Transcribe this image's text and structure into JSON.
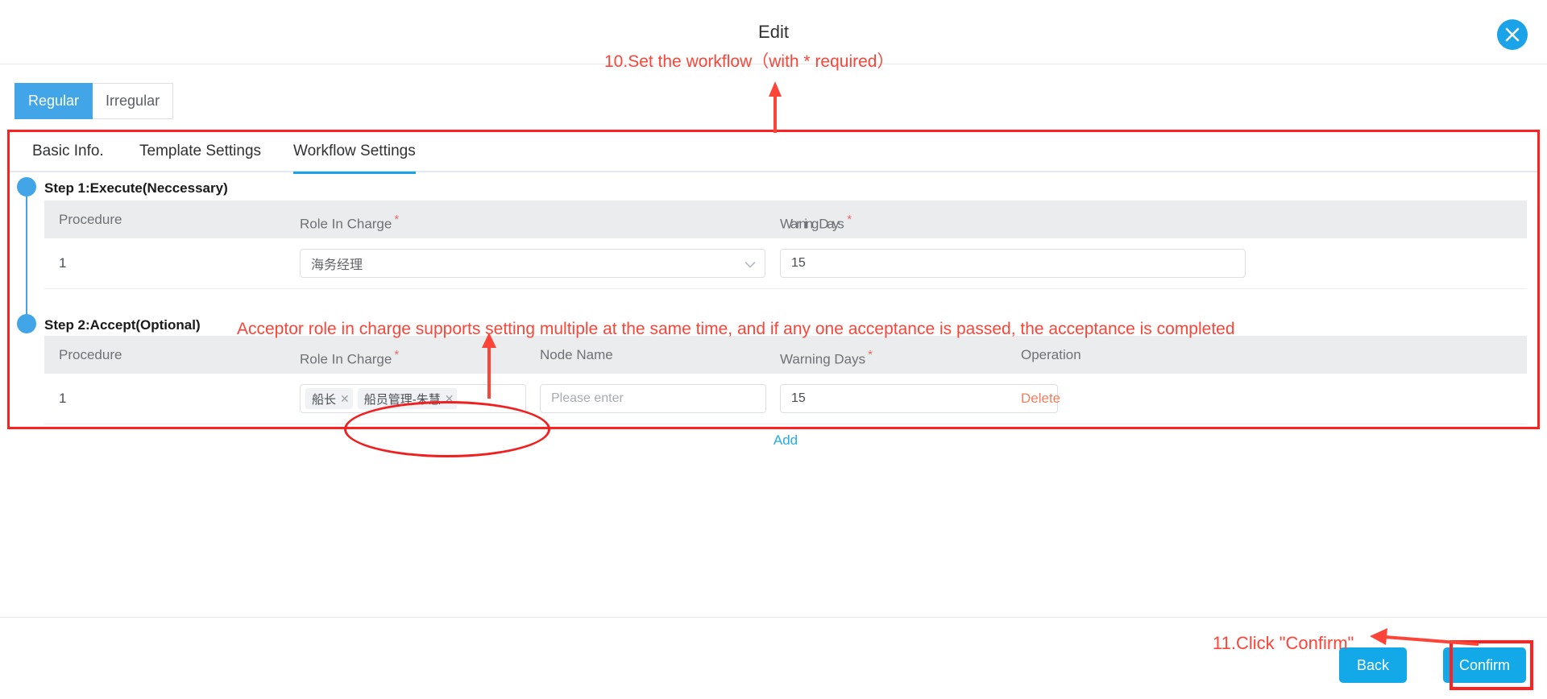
{
  "modal": {
    "title": "Edit",
    "close_icon": "close-icon"
  },
  "segmented": {
    "options": [
      {
        "label": "Regular",
        "active": true
      },
      {
        "label": "Irregular",
        "active": false
      }
    ]
  },
  "tabs": [
    {
      "label": "Basic Info.",
      "active": false
    },
    {
      "label": "Template Settings",
      "active": false
    },
    {
      "label": "Workflow Settings",
      "active": true
    }
  ],
  "steps": [
    {
      "title": "Step 1:Execute(Neccessary)",
      "columns": [
        {
          "label": "Procedure",
          "required": false
        },
        {
          "label": "Role In Charge",
          "required": true
        },
        {
          "label": "Warning Days",
          "required": true
        }
      ],
      "rows": [
        {
          "procedure": "1",
          "role_value": "海务经理",
          "warning_days": "15"
        }
      ]
    },
    {
      "title": "Step 2:Accept(Optional)",
      "columns": [
        {
          "label": "Procedure",
          "required": false
        },
        {
          "label": "Role In Charge",
          "required": true
        },
        {
          "label": "Node Name",
          "required": false
        },
        {
          "label": "Warning Days",
          "required": true
        },
        {
          "label": "Operation",
          "required": false
        }
      ],
      "rows": [
        {
          "procedure": "1",
          "role_tags": [
            "船长",
            "船员管理-朱慧"
          ],
          "node_name_value": "",
          "node_name_placeholder": "Please enter",
          "warning_days": "15",
          "operation_label": "Delete"
        }
      ],
      "add_label": "Add"
    }
  ],
  "footer": {
    "back_label": "Back",
    "confirm_label": "Confirm"
  },
  "annotations": {
    "step10": "10.Set the workflow（with * required）",
    "step2_note": "Acceptor role in charge supports setting multiple at the same time, and if any one acceptance is passed, the acceptance is completed",
    "step11": "11.Click \"Confirm\""
  },
  "colors": {
    "accent": "#41a5e8",
    "annotation": "#fd4438",
    "required": "#f56c6c",
    "delete": "#f08060",
    "link": "#24ace5"
  }
}
